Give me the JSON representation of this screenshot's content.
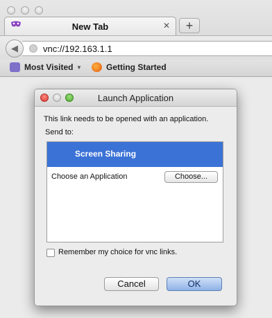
{
  "browser": {
    "tab_title": "New Tab",
    "new_tab_symbol": "+",
    "tab_close_symbol": "✕",
    "back_symbol": "◀",
    "url": "vnc://192.163.1.1",
    "bookmarks": [
      {
        "label": "Most Visited",
        "icon": "most-visited-icon",
        "dropdown": "▼"
      },
      {
        "label": "Getting Started",
        "icon": "firefox-icon"
      }
    ]
  },
  "dialog": {
    "title": "Launch Application",
    "message": "This link needs to be opened with an application.",
    "send_to_label": "Send to:",
    "apps": [
      {
        "label": "Screen Sharing",
        "selected": true
      },
      {
        "label": "Choose an Application",
        "button": "Choose..."
      }
    ],
    "remember_label": "Remember my choice for vnc links.",
    "remember_checked": false,
    "cancel_label": "Cancel",
    "ok_label": "OK"
  },
  "colors": {
    "selection": "#3b72d6",
    "close": "#e0534d",
    "minimize": "#e2b33d",
    "zoom": "#5fb83f"
  }
}
